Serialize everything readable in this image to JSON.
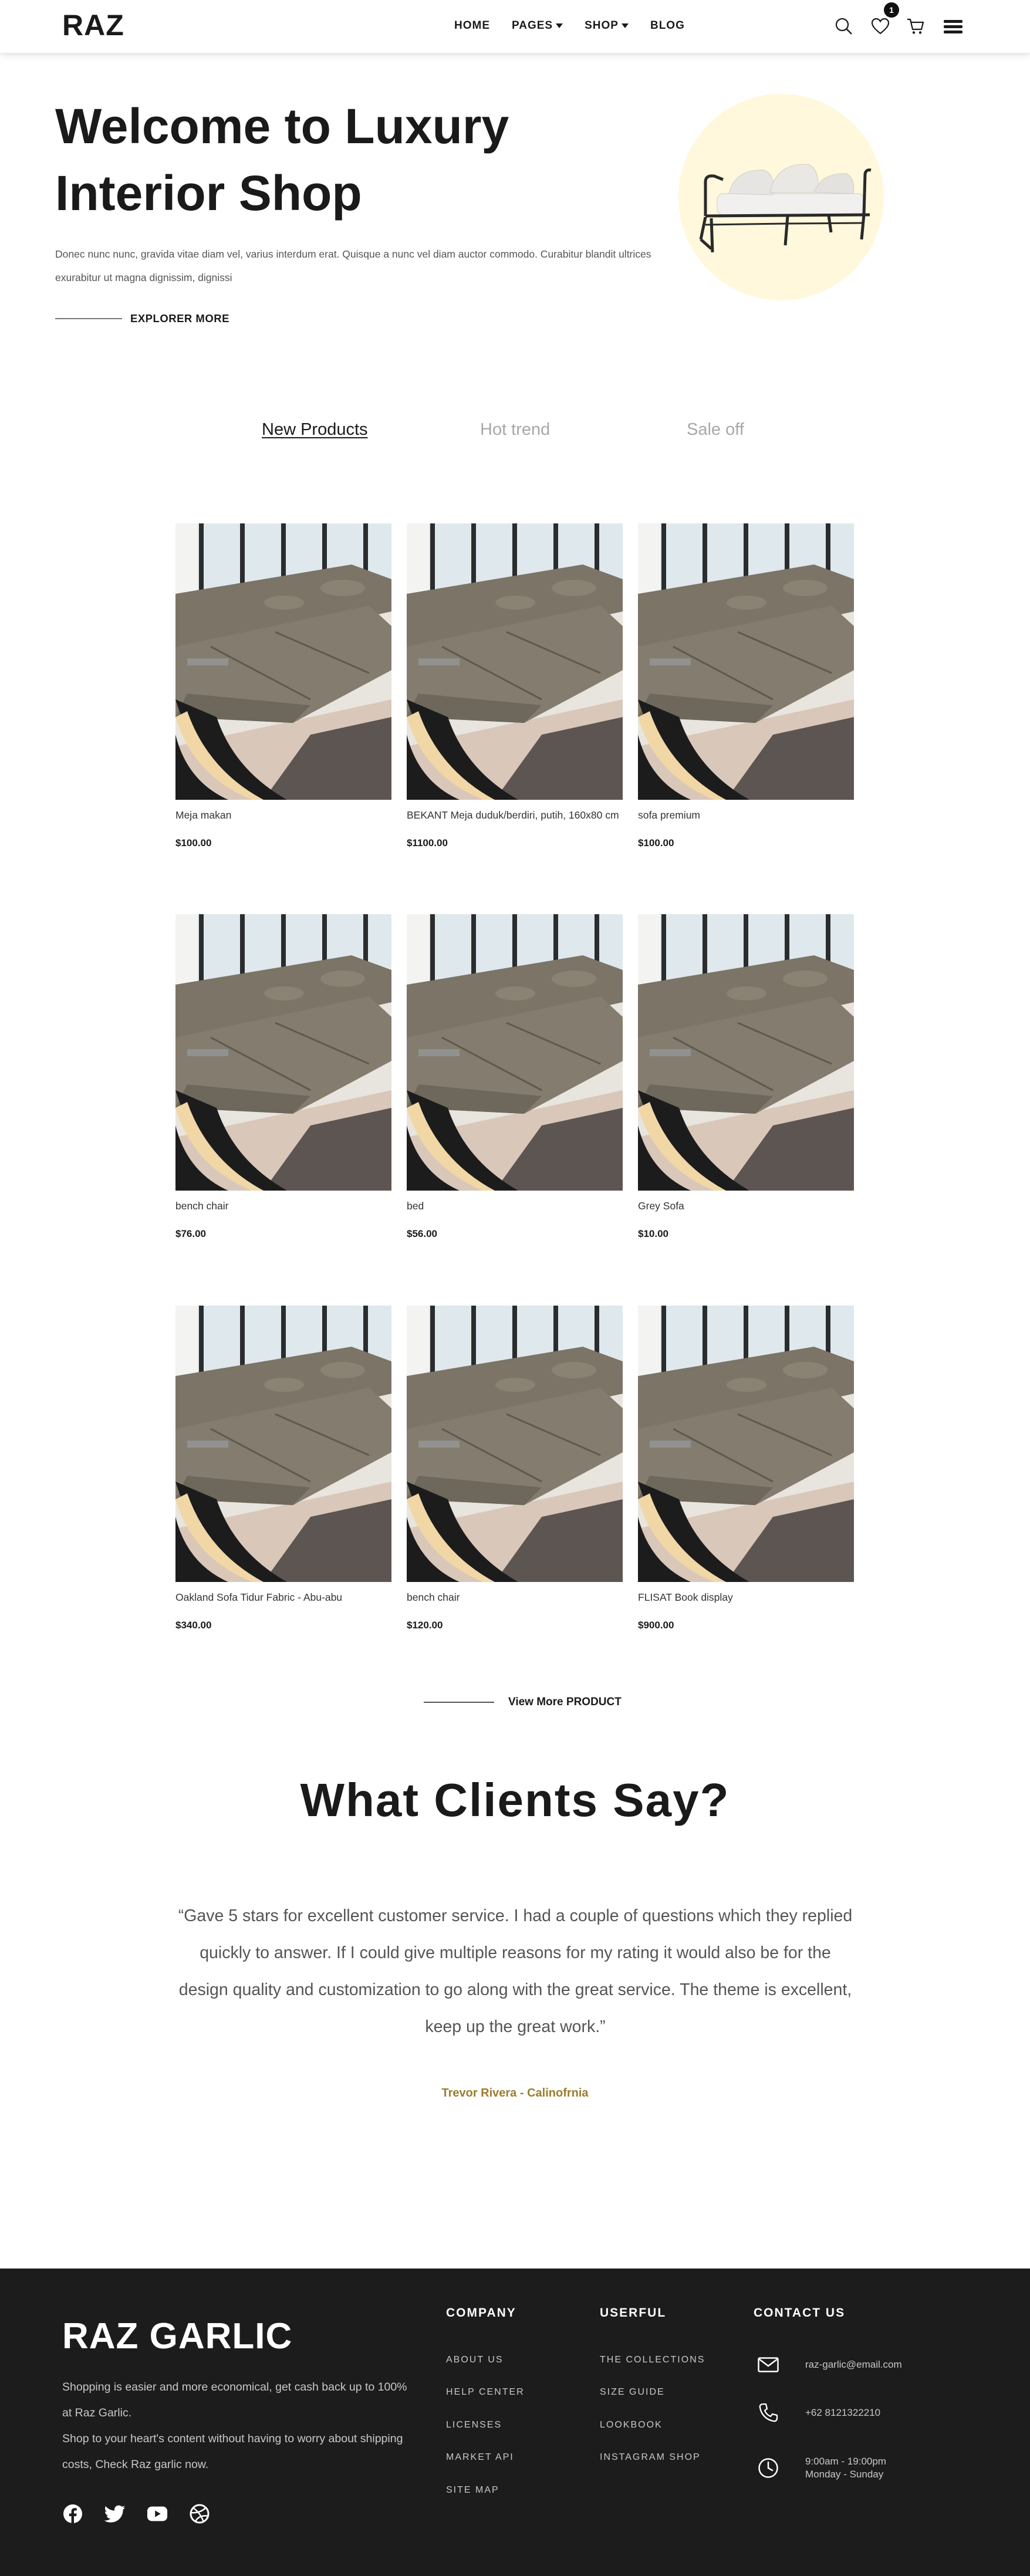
{
  "navbar": {
    "brand": "RAZ",
    "links": [
      {
        "label": "HOME",
        "has_caret": false
      },
      {
        "label": "PAGES",
        "has_caret": true
      },
      {
        "label": "SHOP",
        "has_caret": true
      },
      {
        "label": "BLOG",
        "has_caret": false
      }
    ],
    "icons": [
      "search-icon",
      "heart-icon",
      "cart-icon",
      "menu-icon"
    ],
    "wishlist_count": "1"
  },
  "hero": {
    "title_line1": "Welcome to Luxury",
    "title_line2": "Interior Shop",
    "description": "Donec nunc nunc, gravida vitae diam vel, varius interdum erat. Quisque a nunc vel diam auctor commodo. Curabitur blandit ultrices exurabitur ut magna dignissim, dignissi",
    "cta": "EXPLORER MORE",
    "circle_color": "#fff8dc"
  },
  "tabs": [
    {
      "label": "New Products",
      "active": true
    },
    {
      "label": "Hot trend",
      "active": false
    },
    {
      "label": "Sale off",
      "active": false
    }
  ],
  "products": [
    {
      "name": "Meja makan",
      "price": "$100.00"
    },
    {
      "name": "BEKANT Meja duduk/berdiri, putih, 160x80 cm",
      "price": "$1100.00"
    },
    {
      "name": "sofa premium",
      "price": "$100.00"
    },
    {
      "name": "bench chair",
      "price": "$76.00"
    },
    {
      "name": "bed",
      "price": "$56.00"
    },
    {
      "name": "Grey Sofa",
      "price": "$10.00"
    },
    {
      "name": "Oakland Sofa Tidur Fabric - Abu-abu",
      "price": "$340.00"
    },
    {
      "name": "bench chair",
      "price": "$120.00"
    },
    {
      "name": "FLISAT Book display",
      "price": "$900.00"
    }
  ],
  "view_more": "View More PRODUCT",
  "testimonial": {
    "title": "What Clients Say?",
    "quote": "“Gave 5 stars for excellent customer service. I had a couple of questions which they replied quickly to answer. If I could give multiple reasons for my rating it would also be for the design quality and customization to go along with the great service. The theme is excellent, keep up the great work.”",
    "author": "Trevor Rivera - Calinofrnia",
    "author_color": "#9b7d2d"
  },
  "footer": {
    "brand": "RAZ GARLIC",
    "desc_line1": "Shopping is easier and more economical, get cash back up to 100% at Raz Garlic.",
    "desc_line2": "Shop to your heart's content without having to worry about shipping costs, Check Raz garlic now.",
    "social": [
      "facebook-icon",
      "twitter-icon",
      "youtube-icon",
      "dribbble-icon"
    ],
    "company": {
      "title": "COMPANY",
      "links": [
        "ABOUT US",
        "HELP CENTER",
        "LICENSES",
        "MARKET API",
        "SITE MAP"
      ]
    },
    "userful": {
      "title": "USERFUL",
      "links": [
        "THE COLLECTIONS",
        "SIZE GUIDE",
        "LOOKBOOK",
        "INSTAGRAM SHOP"
      ]
    },
    "contact": {
      "title": "CONTACT US",
      "email": "raz-garlic@email.com",
      "phone": "+62 8121322210",
      "hours": "9:00am - 19:00pm",
      "days": "Monday - Sunday"
    },
    "background": "#1c1c1c"
  }
}
